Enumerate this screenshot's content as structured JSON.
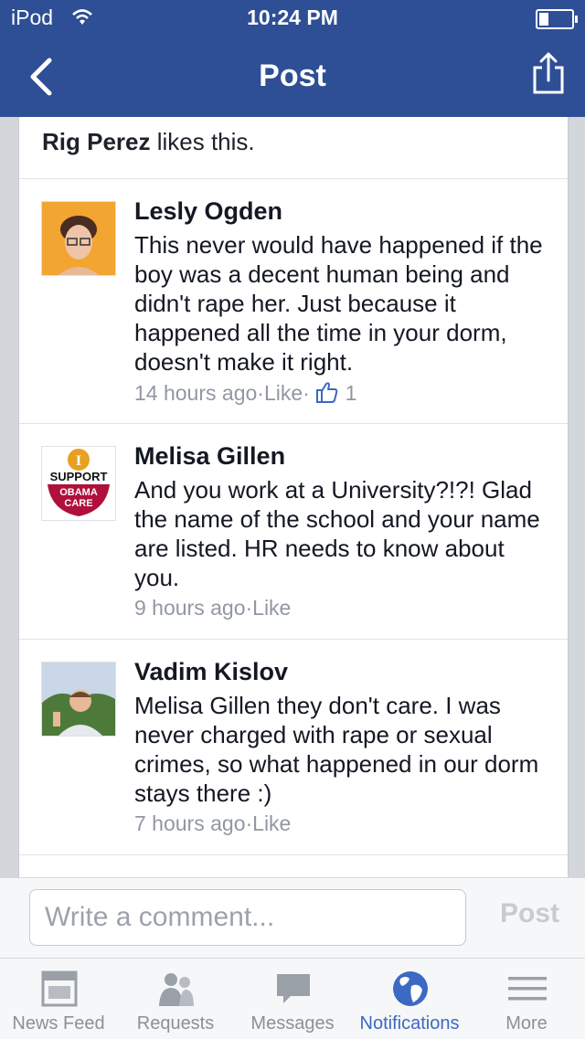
{
  "status_bar": {
    "carrier": "iPod",
    "time": "10:24 PM"
  },
  "nav": {
    "title": "Post",
    "back_icon": "chevron-left-icon",
    "share_icon": "share-icon"
  },
  "likes": {
    "name": "Rig Perez",
    "suffix": " likes this."
  },
  "comments": [
    {
      "name": "Lesly Ogden",
      "text": "This never would have happened if the boy was a decent human being and didn't rape her. Just because it happened all the time in your dorm, doesn't make it right.",
      "time": "14 hours ago",
      "like": "Like",
      "like_count": "1"
    },
    {
      "name": "Melisa Gillen",
      "text": "And you work at a University?!?! Glad the name of the school and your name are listed.  HR needs to know about you.",
      "time": "9 hours ago",
      "like": "Like",
      "avatar_text": {
        "top": "I",
        "mid": "SUPPORT",
        "bottom1": "OBAMA",
        "bottom2": "CARE"
      }
    },
    {
      "name": "Vadim Kislov",
      "text": "Melisa Gillen they don't care. I was never charged with rape or sexual crimes, so what happened in our dorm stays there :)",
      "time": "7 hours ago",
      "like": "Like"
    }
  ],
  "separator": " · ",
  "composer": {
    "placeholder": "Write a comment...",
    "post_label": "Post"
  },
  "tabs": [
    {
      "label": "News Feed",
      "icon": "news-feed-icon"
    },
    {
      "label": "Requests",
      "icon": "friend-requests-icon"
    },
    {
      "label": "Messages",
      "icon": "messages-icon"
    },
    {
      "label": "Notifications",
      "icon": "globe-icon",
      "active": true
    },
    {
      "label": "More",
      "icon": "menu-icon"
    }
  ],
  "colors": {
    "nav_bg": "#2e4f95",
    "active_tab": "#3b69c3",
    "meta_text": "#9197a3"
  }
}
